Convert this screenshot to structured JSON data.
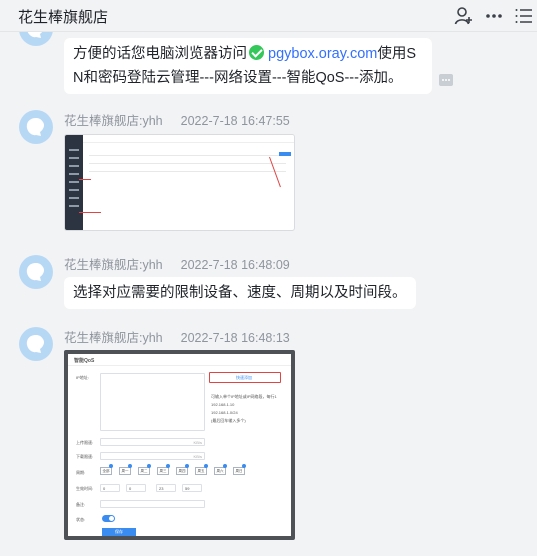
{
  "header": {
    "title": "花生棒旗舰店",
    "icons": [
      "add-user-icon",
      "more-icon",
      "list-icon"
    ]
  },
  "messages": [
    {
      "type": "text",
      "text_before": "方便的话您电脑浏览器访问",
      "link": "pgybox.oray.com",
      "text_line1_after": "使用S",
      "text_line2": "N和密码登陆云管理---网络设置---智能QoS---添加。"
    },
    {
      "sender": "花生棒旗舰店:yhh",
      "time": "2022-7-18 16:47:55",
      "type": "image"
    },
    {
      "sender": "花生棒旗舰店:yhh",
      "time": "2022-7-18 16:48:09",
      "type": "text",
      "text": "选择对应需要的限制设备、速度、周期以及时间段。"
    },
    {
      "sender": "花生棒旗舰店:yhh",
      "time": "2022-7-18 16:48:13",
      "type": "image",
      "image_text": {
        "title": "智能QoS",
        "device_label": "IP地址:",
        "select_label": "快速添加",
        "hint": "可输入单个IP地址或IP网络段，每行1",
        "ip1": "192.168.1.10",
        "ip2": "192.168.1.0/24",
        "hint2": "(最后回车输入多个)",
        "upload_label": "上传限速:",
        "download_label": "下载限速:",
        "unit": "KB/s",
        "cycle_label": "周期:",
        "days": [
          "全部",
          "周一",
          "周二",
          "周三",
          "周四",
          "周五",
          "周六",
          "周日"
        ],
        "time_label": "生效时间:",
        "t1": "0",
        "t2": "0",
        "t3": "23",
        "t4": "59",
        "note_label": "备注:",
        "status_label": "状态:",
        "save": "保存"
      }
    }
  ]
}
